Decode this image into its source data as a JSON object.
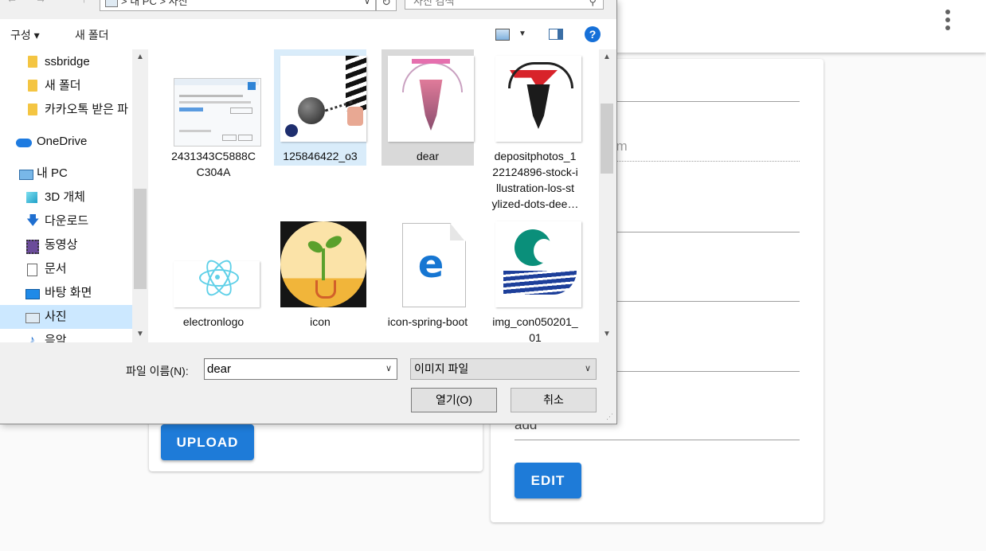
{
  "app": {
    "email_ghost": "om",
    "last_field_value": "add",
    "upload_label": "UPLOAD",
    "edit_label": "EDIT",
    "menu_icon": "more-vert-icon"
  },
  "dialog": {
    "address": {
      "path": "> 내 PC > 사진",
      "search_placeholder": "사진 검색"
    },
    "toolbar": {
      "organize_label": "구성 ▾",
      "new_folder_label": "새 폴더",
      "help_label": "?"
    },
    "nav": {
      "items": [
        {
          "label": "ssbridge",
          "icon": "folder-icon"
        },
        {
          "label": "새 폴더",
          "icon": "folder-icon"
        },
        {
          "label": "카카오톡 받은 파",
          "icon": "folder-icon"
        },
        {
          "label": "OneDrive",
          "icon": "onedrive-icon"
        },
        {
          "label": "내 PC",
          "icon": "pc-icon"
        },
        {
          "label": "3D 개체",
          "icon": "3d-objects-icon"
        },
        {
          "label": "다운로드",
          "icon": "downloads-icon"
        },
        {
          "label": "동영상",
          "icon": "videos-icon"
        },
        {
          "label": "문서",
          "icon": "documents-icon"
        },
        {
          "label": "바탕 화면",
          "icon": "desktop-icon"
        },
        {
          "label": "사진",
          "icon": "pictures-icon"
        },
        {
          "label": "음악",
          "icon": "music-icon"
        }
      ]
    },
    "files": [
      {
        "name": "2431343C5888CC304A",
        "line1": "2431343C5888C",
        "line2": "C304A",
        "thumb": "screenshot-thumbnail"
      },
      {
        "name": "125846422_o3",
        "line1": "125846422_o3",
        "line2": "",
        "thumb": "ball-and-chain-thumbnail"
      },
      {
        "name": "dear",
        "line1": "dear",
        "line2": "",
        "thumb": "deer-illustration-thumbnail"
      },
      {
        "name": "depositphotos_122124896-stock-illustration-los-stylized-dots-dee…",
        "line1": "depositphotos_1",
        "line2": "22124896-stock-i",
        "line3": "llustration-los-st",
        "line4": "ylized-dots-dee…",
        "thumb": "black-deer-thumbnail"
      },
      {
        "name": "electronlogo",
        "line1": "electronlogo",
        "line2": "",
        "thumb": "electron-logo-thumbnail"
      },
      {
        "name": "icon",
        "line1": "icon",
        "line2": "",
        "thumb": "sprout-icon-thumbnail"
      },
      {
        "name": "icon-spring-boot",
        "line1": "icon-spring-boot",
        "line2": "",
        "thumb": "edge-file-icon-thumbnail"
      },
      {
        "name": "img_con050201_01",
        "line1": "img_con050201_",
        "line2": "01",
        "thumb": "green-logo-thumbnail"
      }
    ],
    "bottom": {
      "filename_label": "파일 이름(N):",
      "filename_value": "dear",
      "filetype_value": "이미지 파일",
      "open_label": "열기(O)",
      "cancel_label": "취소"
    }
  }
}
